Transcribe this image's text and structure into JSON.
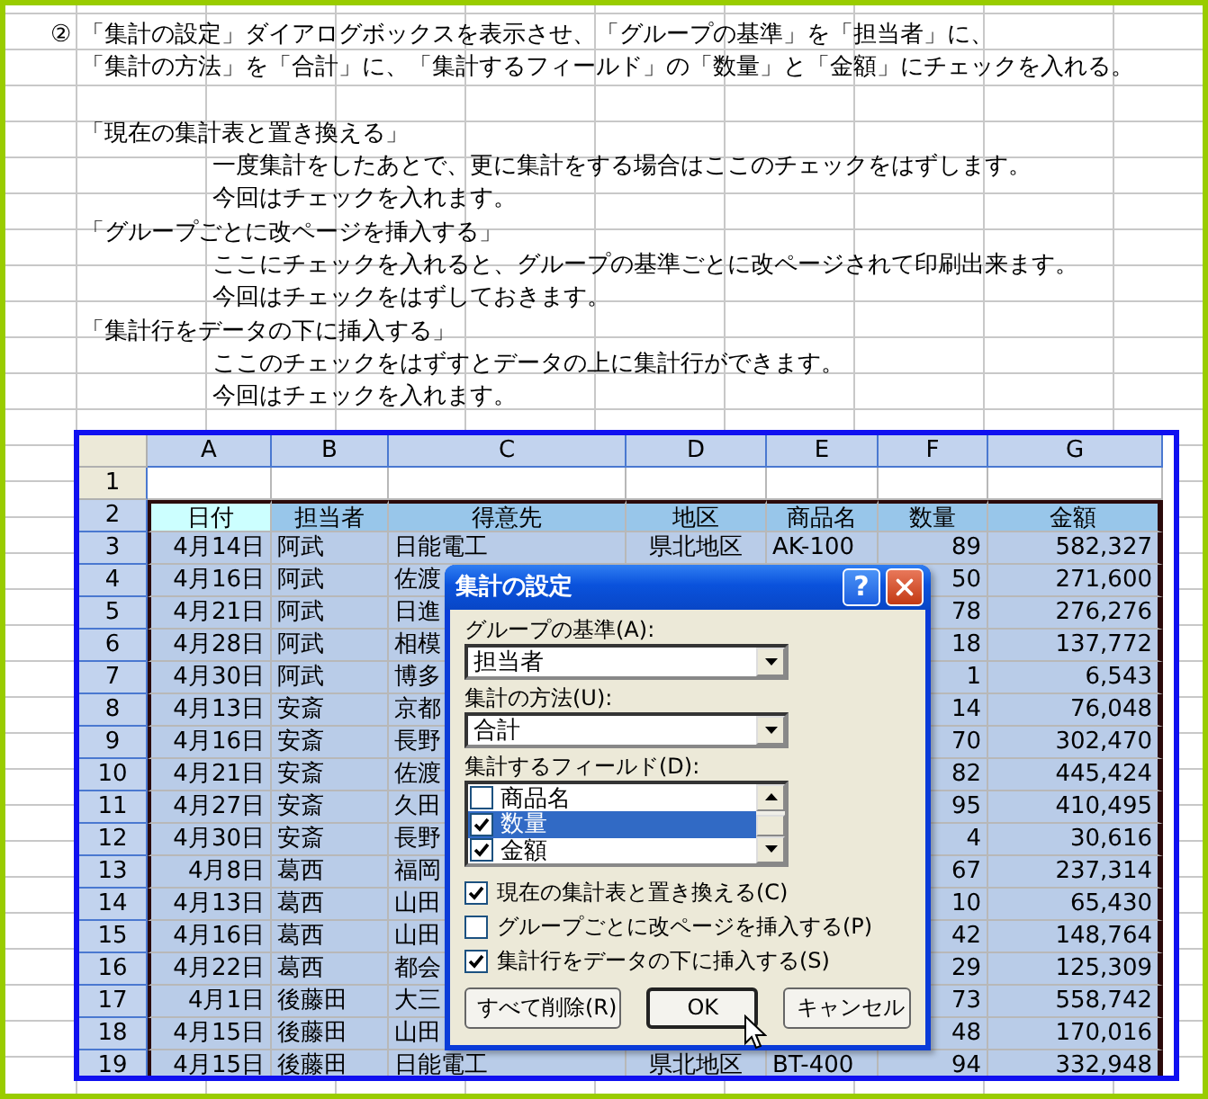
{
  "step": {
    "marker": "②",
    "lines": [
      "「集計の設定」ダイアログボックスを表示させ、「グループの基準」を「担当者」に、",
      "「集計の方法」を「合計」に、「集計するフィールド」の「数量」と「金額」にチェックを入れる。"
    ]
  },
  "notes": [
    {
      "text": "「現在の集計表と置き換える」",
      "children": [
        {
          "text": "一度集計をしたあとで、更に集計をする場合はここのチェックをはずします。"
        },
        {
          "text": "今回はチェックを入れます。"
        }
      ]
    },
    {
      "text": "「グループごとに改ページを挿入する」",
      "children": [
        {
          "text": "ここにチェックを入れると、グループの基準ごとに改ページされて印刷出来ます。"
        },
        {
          "text": "今回はチェックをはずしておきます。"
        }
      ]
    },
    {
      "text": "「集計行をデータの下に挿入する」",
      "children": [
        {
          "text": "ここのチェックをはずすとデータの上に集計行ができます。"
        },
        {
          "text": "今回はチェックを入れます。"
        }
      ]
    }
  ],
  "sheet": {
    "columns": [
      {
        "label": "A",
        "selected": true
      },
      {
        "label": "B",
        "selected": true
      },
      {
        "label": "C",
        "selected": true
      },
      {
        "label": "D",
        "selected": true
      },
      {
        "label": "E",
        "selected": true
      },
      {
        "label": "F",
        "selected": true
      },
      {
        "label": "G",
        "selected": true
      }
    ],
    "rows": [
      {
        "number": "1",
        "selected": false,
        "kind": "data",
        "cells": {}
      },
      {
        "number": "2",
        "selected": true,
        "kind": "header",
        "active": {
          "a": true
        },
        "cells": {
          "a": "日付",
          "b": "担当者",
          "c": "得意先",
          "d": "地区",
          "e": "商品名",
          "f": "数量",
          "g": "金額"
        }
      },
      {
        "number": "3",
        "selected": true,
        "kind": "data",
        "cells": {
          "a": "4月14日",
          "b": "阿武",
          "c": "日能電工",
          "d": "県北地区",
          "e": "AK-100",
          "f": "89",
          "g": "582,327"
        }
      },
      {
        "number": "4",
        "selected": true,
        "kind": "data",
        "cells": {
          "a": "4月16日",
          "b": "阿武",
          "c": "佐渡",
          "f": "50",
          "g": "271,600"
        }
      },
      {
        "number": "5",
        "selected": true,
        "kind": "data",
        "cells": {
          "a": "4月21日",
          "b": "阿武",
          "c": "日進",
          "f": "78",
          "g": "276,276"
        }
      },
      {
        "number": "6",
        "selected": true,
        "kind": "data",
        "cells": {
          "a": "4月28日",
          "b": "阿武",
          "c": "相模",
          "f": "18",
          "g": "137,772"
        }
      },
      {
        "number": "7",
        "selected": true,
        "kind": "data",
        "cells": {
          "a": "4月30日",
          "b": "阿武",
          "c": "博多",
          "f": "1",
          "g": "6,543"
        }
      },
      {
        "number": "8",
        "selected": true,
        "kind": "data",
        "cells": {
          "a": "4月13日",
          "b": "安斎",
          "c": "京都",
          "f": "14",
          "g": "76,048"
        }
      },
      {
        "number": "9",
        "selected": true,
        "kind": "data",
        "cells": {
          "a": "4月16日",
          "b": "安斎",
          "c": "長野",
          "f": "70",
          "g": "302,470"
        }
      },
      {
        "number": "10",
        "selected": true,
        "kind": "data",
        "cells": {
          "a": "4月21日",
          "b": "安斎",
          "c": "佐渡",
          "f": "82",
          "g": "445,424"
        }
      },
      {
        "number": "11",
        "selected": true,
        "kind": "data",
        "cells": {
          "a": "4月27日",
          "b": "安斎",
          "c": "久田",
          "f": "95",
          "g": "410,495"
        }
      },
      {
        "number": "12",
        "selected": true,
        "kind": "data",
        "cells": {
          "a": "4月30日",
          "b": "安斎",
          "c": "長野",
          "f": "4",
          "g": "30,616"
        }
      },
      {
        "number": "13",
        "selected": true,
        "kind": "data",
        "cells": {
          "a": "4月8日",
          "b": "葛西",
          "c": "福岡",
          "f": "67",
          "g": "237,314"
        }
      },
      {
        "number": "14",
        "selected": true,
        "kind": "data",
        "cells": {
          "a": "4月13日",
          "b": "葛西",
          "c": "山田",
          "f": "10",
          "g": "65,430"
        }
      },
      {
        "number": "15",
        "selected": true,
        "kind": "data",
        "cells": {
          "a": "4月16日",
          "b": "葛西",
          "c": "山田",
          "f": "42",
          "g": "148,764"
        }
      },
      {
        "number": "16",
        "selected": true,
        "kind": "data",
        "cells": {
          "a": "4月22日",
          "b": "葛西",
          "c": "都会",
          "f": "29",
          "g": "125,309"
        }
      },
      {
        "number": "17",
        "selected": true,
        "kind": "data",
        "cells": {
          "a": "4月1日",
          "b": "後藤田",
          "c": "大三",
          "f": "73",
          "g": "558,742"
        }
      },
      {
        "number": "18",
        "selected": true,
        "kind": "data",
        "cells": {
          "a": "4月15日",
          "b": "後藤田",
          "c": "山田",
          "f": "48",
          "g": "170,016"
        }
      },
      {
        "number": "19",
        "selected": true,
        "kind": "data",
        "cells": {
          "a": "4月15日",
          "b": "後藤田",
          "c": "日能電工",
          "d": "県北地区",
          "e": "BT-400",
          "f": "94",
          "g": "332,948"
        }
      }
    ]
  },
  "dialog": {
    "title": "集計の設定",
    "help": "?",
    "group_by": {
      "label": "グループの基準(A):",
      "value": "担当者"
    },
    "method": {
      "label": "集計の方法(U):",
      "value": "合計"
    },
    "fields": {
      "label": "集計するフィールド(D):",
      "items": [
        {
          "label": "商品名",
          "checked": false,
          "selected": false
        },
        {
          "label": "数量",
          "checked": true,
          "selected": true
        },
        {
          "label": "金額",
          "checked": true,
          "selected": false
        }
      ]
    },
    "options": [
      {
        "label": "現在の集計表と置き換える(C)",
        "checked": true
      },
      {
        "label": "グループごとに改ページを挿入する(P)",
        "checked": false
      },
      {
        "label": "集計行をデータの下に挿入する(S)",
        "checked": true
      }
    ],
    "buttons": [
      {
        "label": "すべて削除(R)",
        "default": false
      },
      {
        "label": "OK",
        "default": true
      },
      {
        "label": "キャンセル",
        "default": false
      }
    ]
  }
}
